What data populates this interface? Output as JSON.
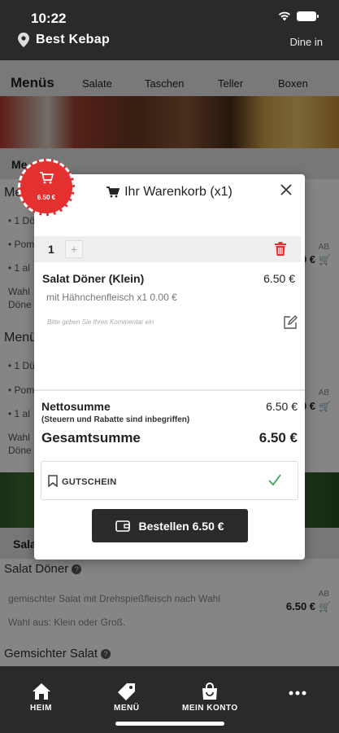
{
  "status": {
    "time": "10:22"
  },
  "header": {
    "location": "Best Kebap",
    "mode": "Dine in"
  },
  "categories": {
    "active": "Menüs",
    "items": [
      "Salate",
      "Taschen",
      "Teller",
      "Boxen"
    ]
  },
  "background": {
    "section1_title": "Me",
    "menu1_title": "Me",
    "menu1_lines": [
      "• 1 Dö",
      "• Pom",
      "• 1 al",
      "Wahl",
      "Döne"
    ],
    "menu1_price_ab": "AB",
    "menu1_price": "0 €",
    "menu2_title": "Menü",
    "menu2_lines": [
      "• 1 Dü",
      "• Pom",
      "• 1 al",
      "Wahl",
      "Döne"
    ],
    "menu2_price_ab": "AB",
    "menu2_price": "0 €",
    "section2_title": "Sala",
    "salat_doener": {
      "title": "Salat Döner",
      "desc": "gemischter Salat mit Drehspießfleisch nach Wahl",
      "choice": "Wahl aus: Klein oder Groß.",
      "price_ab": "AB",
      "price": "6.50 €"
    },
    "gemischter_salat": {
      "title": "Gemsichter Salat"
    }
  },
  "badge": {
    "price": "6.50 €"
  },
  "cart": {
    "title": "Ihr Warenkorb (x1)",
    "quantity": "1",
    "plus": "+",
    "item_name": "Salat Döner (Klein)",
    "item_price": "6.50 €",
    "item_option": "mit Hähnchenfleisch x1 0.00 €",
    "comment_placeholder": "Bitte geben Sie Ihren Kommentar ein",
    "netto_label": "Nettosumme",
    "netto_value": "6.50 €",
    "tax_note": "(Steuern und Rabatte sind inbegriffen)",
    "total_label": "Gesamtsumme",
    "total_value": "6.50 €",
    "voucher_label": "GUTSCHEIN",
    "order_button": "Bestellen 6.50 €"
  },
  "bottom_nav": {
    "home": "HEIM",
    "menu": "MENÜ",
    "account": "MEIN KONTO"
  },
  "colors": {
    "accent_red": "#e53030",
    "dark": "#2a2a2a",
    "check_green": "#3aa75a"
  }
}
